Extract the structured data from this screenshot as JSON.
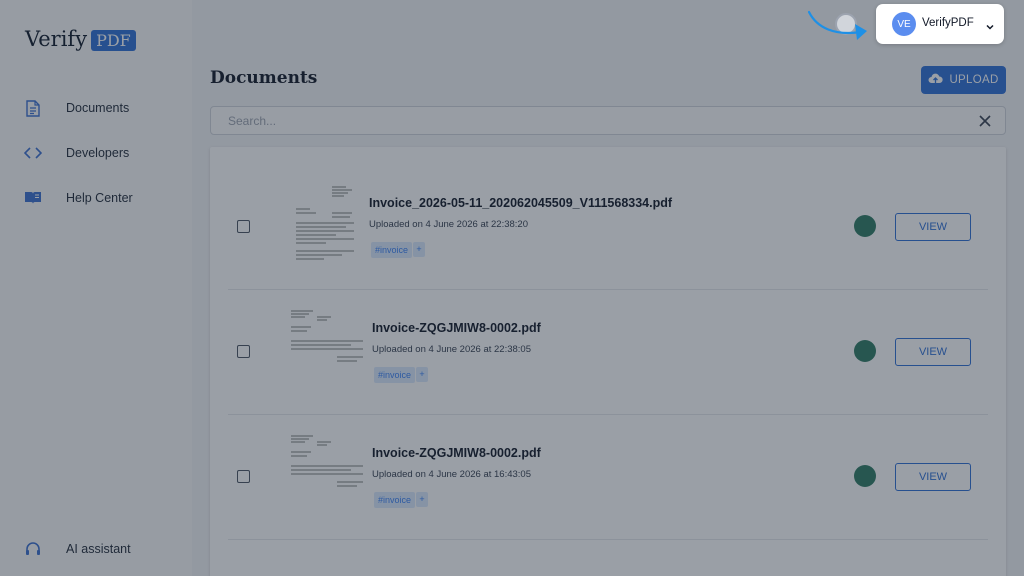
{
  "brand": {
    "word": "Verify",
    "badge": "PDF"
  },
  "sidebar": {
    "items": [
      {
        "label": "Documents",
        "icon": "document-icon"
      },
      {
        "label": "Developers",
        "icon": "code-icon"
      },
      {
        "label": "Help Center",
        "icon": "book-icon"
      }
    ],
    "bottom": {
      "label": "AI assistant",
      "icon": "headset-icon"
    }
  },
  "main": {
    "title": "Documents",
    "upload_label": "UPLOAD",
    "search_placeholder": "Search..."
  },
  "documents": [
    {
      "name": "Invoice_2026-05-11_202062045509_V111568334.pdf",
      "uploaded": "Uploaded on 4 June 2026 at 22:38:20",
      "tag": "#invoice",
      "add": "+",
      "view": "VIEW"
    },
    {
      "name": "Invoice-ZQGJMIW8-0002.pdf",
      "uploaded": "Uploaded on 4 June 2026 at 22:38:05",
      "tag": "#invoice",
      "add": "+",
      "view": "VIEW"
    },
    {
      "name": "Invoice-ZQGJMIW8-0002.pdf",
      "uploaded": "Uploaded on 4 June 2026 at 16:43:05",
      "tag": "#invoice",
      "add": "+",
      "view": "VIEW"
    }
  ],
  "account": {
    "initials": "VE",
    "name": "VerifyPDF"
  },
  "colors": {
    "accent": "#2f6fd6",
    "status": "#2f7a63",
    "overlay": "rgba(30,42,58,0.45)"
  }
}
